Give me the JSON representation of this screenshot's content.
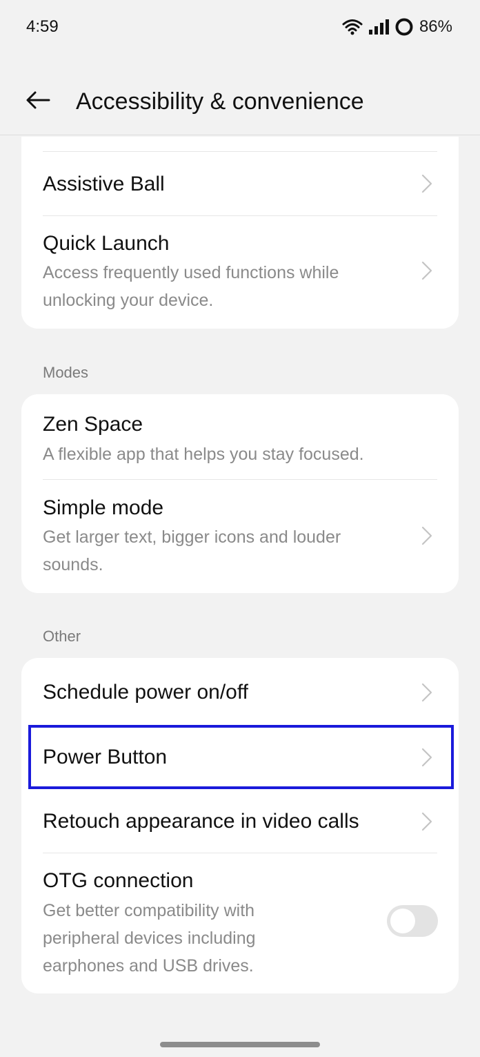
{
  "status": {
    "time": "4:59",
    "battery": "86%",
    "icons": [
      "wifi-icon",
      "signal-icon",
      "battery-ring-icon"
    ]
  },
  "header": {
    "back_icon": "back-arrow-icon",
    "title": "Accessibility & convenience"
  },
  "top_card": {
    "items": [
      {
        "title": "Assistive Ball"
      },
      {
        "title": "Quick Launch",
        "desc": "Access frequently used functions while unlocking your device."
      }
    ]
  },
  "modes": {
    "label": "Modes",
    "items": [
      {
        "title": "Zen Space",
        "desc": "A flexible app that helps you stay focused."
      },
      {
        "title": "Simple mode",
        "desc": "Get larger text, bigger icons and louder sounds."
      }
    ]
  },
  "other": {
    "label": "Other",
    "items": [
      {
        "title": "Schedule power on/off"
      },
      {
        "title": "Power Button"
      },
      {
        "title": "Retouch appearance in video calls"
      },
      {
        "title": "OTG connection",
        "desc": "Get better compatibility with peripheral devices including earphones and USB drives.",
        "toggle": "off"
      }
    ]
  },
  "colors": {
    "highlight": "#1a1adb",
    "card": "#ffffff",
    "background": "#f2f2f2"
  }
}
